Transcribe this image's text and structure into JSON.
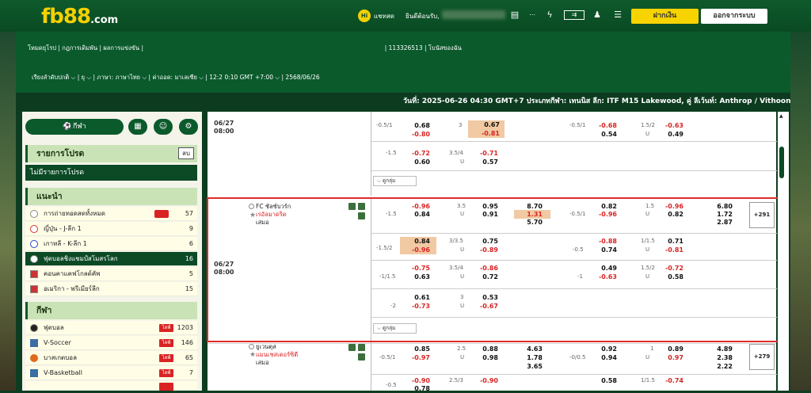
{
  "header": {
    "logo_main": "fb88",
    "logo_dot": ".com",
    "chat": "แชทสด",
    "welcome": "ยินดีต้อนรับ,",
    "deposit": "ฝากเงิน",
    "logout": "ออกจากระบบ"
  },
  "settings": {
    "link1": "โหมดยุโรป",
    "link2": "กฎการเดิมพัน",
    "link3": "ผลการแข่งขัน",
    "account_id": "113326513",
    "my_bonus": "โบนัสของฉัน",
    "sort": "เรียงลำดับปกติ",
    "odds_mode": "ยุ",
    "language": "ภาษา: ภาษาไทย",
    "odds_type": "ค่าออด: มาเลเซีย",
    "clock": "12:2 0:10 GMT +7:00",
    "date": "2568/06/26"
  },
  "ticker": "วันที่: 2025-06-26 04:30 GMT+7 ประเภทกีฬา: เทนนิส ลีก: ITF M15 Lakewood, คู่ ลีเว้นท์: Anthrop / Vithoontien vs แอน",
  "sidebar": {
    "sport_label": "กีฬา",
    "fav_title": "รายการโปรด",
    "fav_btn": "ลบ",
    "no_fav": "ไม่มีรายการโปรด",
    "rec_title": "แนะนำ",
    "rec_items": [
      {
        "label": "การถ่ายทอดสดทั้งหมด",
        "count": "57"
      },
      {
        "label": "ญี่ปุ่น - J-ลีก 1",
        "count": "9"
      },
      {
        "label": "เกาหลี - K-ลีก 1",
        "count": "6"
      },
      {
        "label": "ฟุตบอลชิงแชมป์สโมสรโลก",
        "count": "16"
      },
      {
        "label": "คอนคาแคฟโกลด์คัพ",
        "count": "5"
      },
      {
        "label": "อเมริกา - พรีเมียร์ลีก",
        "count": "15"
      }
    ],
    "sports_title": "กีฬา",
    "sports": [
      {
        "label": "ฟุตบอล",
        "live": "ไลฟ์",
        "count": "1203"
      },
      {
        "label": "V-Soccer",
        "live": "ไลฟ์",
        "count": "146"
      },
      {
        "label": "บาสเกตบอล",
        "live": "ไลฟ์",
        "count": "65"
      },
      {
        "label": "V-Basketball",
        "live": "ไลฟ์",
        "count": "7"
      }
    ]
  },
  "main": {
    "match1": {
      "date": "06/27",
      "time": "08:00",
      "more": "ดูกลุ่ม",
      "rows": [
        [
          "-0.5/1",
          "0.68",
          "-0.80",
          "3",
          "0.67",
          "-0.81",
          "-0.5/1",
          "-0.68",
          "0.54",
          "1.5/2",
          "U",
          "-0.63",
          "0.49"
        ],
        [
          "-1.5",
          "-0.72",
          "0.60",
          "3.5/4",
          "U",
          "-0.71",
          "0.57"
        ]
      ]
    },
    "match2": {
      "date": "06/27",
      "time": "08:00",
      "home": "FC ชัลซ์บวร์ก",
      "away": "เรอัลมาดริด",
      "draw": "เสมอ",
      "more": "ดูกลุ่ม",
      "more_count": "+291",
      "rows": [
        [
          "-1.5",
          "-0.96",
          "0.84",
          "3.5",
          "U",
          "0.95",
          "0.91",
          "8.70",
          "1.31",
          "5.70",
          "-0.5/1",
          "0.82",
          "-0.96",
          "1.5",
          "U",
          "-0.96",
          "0.82",
          "6.80",
          "1.72",
          "2.87"
        ],
        [
          "-1.5/2",
          "0.84",
          "-0.96",
          "3/3.5",
          "U",
          "0.75",
          "-0.89",
          "-0.5",
          "-0.88",
          "0.74",
          "1/1.5",
          "U",
          "0.71",
          "-0.81"
        ],
        [
          "-1/1.5",
          "-0.75",
          "0.63",
          "3.5/4",
          "U",
          "-0.86",
          "0.72",
          "-1",
          "0.49",
          "-0.63",
          "1.5/2",
          "U",
          "-0.72",
          "0.58"
        ],
        [
          "-2",
          "0.61",
          "-0.73",
          "3",
          "U",
          "0.53",
          "-0.67"
        ]
      ]
    },
    "match3": {
      "home": "ยูเวนตุส",
      "away": "แมนเชสเตอร์ซิตี",
      "draw": "เสมอ",
      "more_count": "+279",
      "rows": [
        [
          "-0.5/1",
          "0.85",
          "-0.97",
          "2.5",
          "U",
          "0.88",
          "0.98",
          "4.63",
          "1.78",
          "3.65",
          "-0/0.5",
          "0.92",
          "0.94",
          "1",
          "U",
          "0.89",
          "0.97",
          "4.89",
          "2.38",
          "2.22"
        ],
        [
          "-0.5",
          "-0.90",
          "0.78",
          "2.5/3",
          "-0.90",
          "0.58",
          "-0.74",
          "1/1.5"
        ]
      ]
    }
  }
}
